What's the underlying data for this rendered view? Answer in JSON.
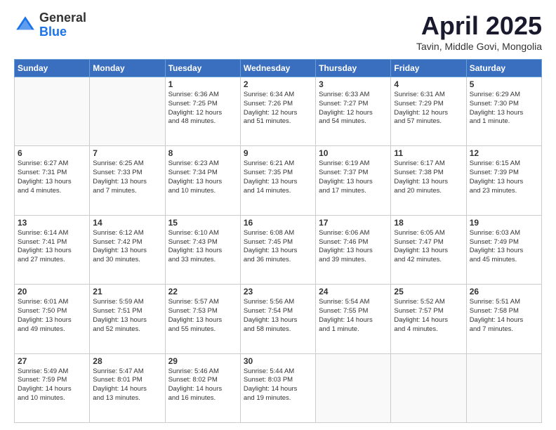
{
  "logo": {
    "general": "General",
    "blue": "Blue"
  },
  "header": {
    "title": "April 2025",
    "subtitle": "Tavin, Middle Govi, Mongolia"
  },
  "weekdays": [
    "Sunday",
    "Monday",
    "Tuesday",
    "Wednesday",
    "Thursday",
    "Friday",
    "Saturday"
  ],
  "weeks": [
    [
      {
        "day": "",
        "info": ""
      },
      {
        "day": "",
        "info": ""
      },
      {
        "day": "1",
        "info": "Sunrise: 6:36 AM\nSunset: 7:25 PM\nDaylight: 12 hours\nand 48 minutes."
      },
      {
        "day": "2",
        "info": "Sunrise: 6:34 AM\nSunset: 7:26 PM\nDaylight: 12 hours\nand 51 minutes."
      },
      {
        "day": "3",
        "info": "Sunrise: 6:33 AM\nSunset: 7:27 PM\nDaylight: 12 hours\nand 54 minutes."
      },
      {
        "day": "4",
        "info": "Sunrise: 6:31 AM\nSunset: 7:29 PM\nDaylight: 12 hours\nand 57 minutes."
      },
      {
        "day": "5",
        "info": "Sunrise: 6:29 AM\nSunset: 7:30 PM\nDaylight: 13 hours\nand 1 minute."
      }
    ],
    [
      {
        "day": "6",
        "info": "Sunrise: 6:27 AM\nSunset: 7:31 PM\nDaylight: 13 hours\nand 4 minutes."
      },
      {
        "day": "7",
        "info": "Sunrise: 6:25 AM\nSunset: 7:33 PM\nDaylight: 13 hours\nand 7 minutes."
      },
      {
        "day": "8",
        "info": "Sunrise: 6:23 AM\nSunset: 7:34 PM\nDaylight: 13 hours\nand 10 minutes."
      },
      {
        "day": "9",
        "info": "Sunrise: 6:21 AM\nSunset: 7:35 PM\nDaylight: 13 hours\nand 14 minutes."
      },
      {
        "day": "10",
        "info": "Sunrise: 6:19 AM\nSunset: 7:37 PM\nDaylight: 13 hours\nand 17 minutes."
      },
      {
        "day": "11",
        "info": "Sunrise: 6:17 AM\nSunset: 7:38 PM\nDaylight: 13 hours\nand 20 minutes."
      },
      {
        "day": "12",
        "info": "Sunrise: 6:15 AM\nSunset: 7:39 PM\nDaylight: 13 hours\nand 23 minutes."
      }
    ],
    [
      {
        "day": "13",
        "info": "Sunrise: 6:14 AM\nSunset: 7:41 PM\nDaylight: 13 hours\nand 27 minutes."
      },
      {
        "day": "14",
        "info": "Sunrise: 6:12 AM\nSunset: 7:42 PM\nDaylight: 13 hours\nand 30 minutes."
      },
      {
        "day": "15",
        "info": "Sunrise: 6:10 AM\nSunset: 7:43 PM\nDaylight: 13 hours\nand 33 minutes."
      },
      {
        "day": "16",
        "info": "Sunrise: 6:08 AM\nSunset: 7:45 PM\nDaylight: 13 hours\nand 36 minutes."
      },
      {
        "day": "17",
        "info": "Sunrise: 6:06 AM\nSunset: 7:46 PM\nDaylight: 13 hours\nand 39 minutes."
      },
      {
        "day": "18",
        "info": "Sunrise: 6:05 AM\nSunset: 7:47 PM\nDaylight: 13 hours\nand 42 minutes."
      },
      {
        "day": "19",
        "info": "Sunrise: 6:03 AM\nSunset: 7:49 PM\nDaylight: 13 hours\nand 45 minutes."
      }
    ],
    [
      {
        "day": "20",
        "info": "Sunrise: 6:01 AM\nSunset: 7:50 PM\nDaylight: 13 hours\nand 49 minutes."
      },
      {
        "day": "21",
        "info": "Sunrise: 5:59 AM\nSunset: 7:51 PM\nDaylight: 13 hours\nand 52 minutes."
      },
      {
        "day": "22",
        "info": "Sunrise: 5:57 AM\nSunset: 7:53 PM\nDaylight: 13 hours\nand 55 minutes."
      },
      {
        "day": "23",
        "info": "Sunrise: 5:56 AM\nSunset: 7:54 PM\nDaylight: 13 hours\nand 58 minutes."
      },
      {
        "day": "24",
        "info": "Sunrise: 5:54 AM\nSunset: 7:55 PM\nDaylight: 14 hours\nand 1 minute."
      },
      {
        "day": "25",
        "info": "Sunrise: 5:52 AM\nSunset: 7:57 PM\nDaylight: 14 hours\nand 4 minutes."
      },
      {
        "day": "26",
        "info": "Sunrise: 5:51 AM\nSunset: 7:58 PM\nDaylight: 14 hours\nand 7 minutes."
      }
    ],
    [
      {
        "day": "27",
        "info": "Sunrise: 5:49 AM\nSunset: 7:59 PM\nDaylight: 14 hours\nand 10 minutes."
      },
      {
        "day": "28",
        "info": "Sunrise: 5:47 AM\nSunset: 8:01 PM\nDaylight: 14 hours\nand 13 minutes."
      },
      {
        "day": "29",
        "info": "Sunrise: 5:46 AM\nSunset: 8:02 PM\nDaylight: 14 hours\nand 16 minutes."
      },
      {
        "day": "30",
        "info": "Sunrise: 5:44 AM\nSunset: 8:03 PM\nDaylight: 14 hours\nand 19 minutes."
      },
      {
        "day": "",
        "info": ""
      },
      {
        "day": "",
        "info": ""
      },
      {
        "day": "",
        "info": ""
      }
    ]
  ]
}
